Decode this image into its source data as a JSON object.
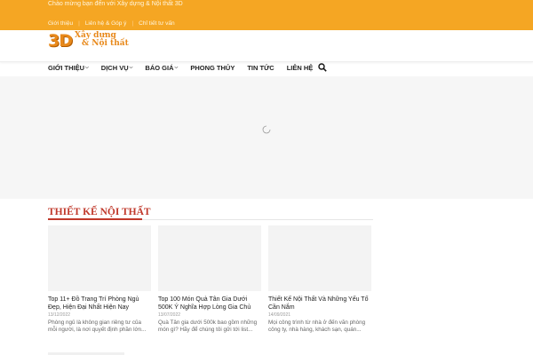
{
  "topbar": {
    "welcome": "Chào mừng bạn đến với Xây dựng & Nội thất 3D",
    "links": [
      "Giới thiệu",
      "Liên hệ & Góp ý",
      "Chỉ tiết tư vấn"
    ]
  },
  "logo": {
    "mark": "3D",
    "line1": "Xây dựng",
    "line2": "& Nội thất"
  },
  "nav": {
    "items": [
      {
        "label": "GIỚI THIỆU",
        "dropdown": true
      },
      {
        "label": "DỊCH VỤ",
        "dropdown": true
      },
      {
        "label": "BÁO GIÁ",
        "dropdown": true
      },
      {
        "label": "PHONG THỦY",
        "dropdown": false
      },
      {
        "label": "TIN TỨC",
        "dropdown": false
      },
      {
        "label": "LIÊN HỆ",
        "dropdown": false
      }
    ]
  },
  "section": {
    "title": "THIẾT KẾ NỘI THẤT"
  },
  "posts": [
    {
      "title": "Top 11+ Đồ Trang Trí Phòng Ngủ Đẹp, Hiện Đại Nhất Hiện Nay",
      "date": "13/12/2022",
      "excerpt": "Phòng ngủ là không gian riêng tư của mỗi người, là nơi quyết định phần lớn..."
    },
    {
      "title": "Top 100 Món Quà Tân Gia Dưới 500K Ý Nghĩa Hợp Lòng Gia Chủ",
      "date": "13/07/2022",
      "excerpt": "Quà Tân gia dưới 500k bao gồm những món gì? Hãy để chúng tôi gửi tới list..."
    },
    {
      "title": "Thiết Kế Nội Thất Và Những Yếu Tố Cần Nắm",
      "date": "14/09/2021",
      "excerpt": "Mọi công trình từ nhà ở đến văn phòng công ty, nhà hàng, khách sạn, quán..."
    }
  ],
  "colors": {
    "topbar": "#f5a623",
    "accent": "#c0392b",
    "logo": "#e8891b"
  }
}
